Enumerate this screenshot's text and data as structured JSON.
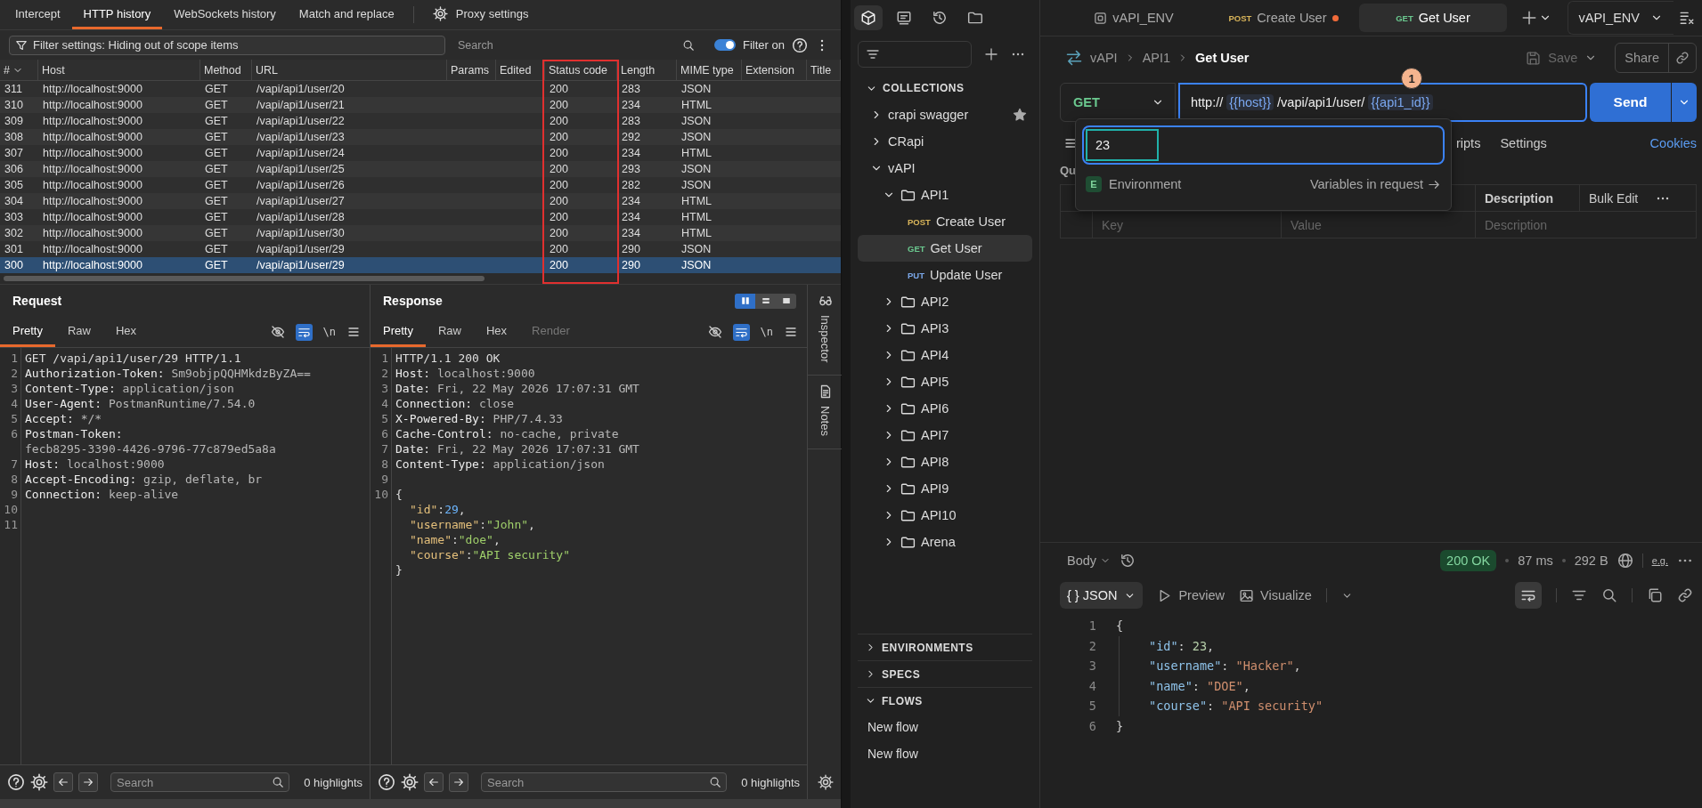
{
  "burp": {
    "tabs": [
      {
        "label": "Intercept",
        "selected": false
      },
      {
        "label": "HTTP history",
        "selected": true
      },
      {
        "label": "WebSockets history",
        "selected": false
      },
      {
        "label": "Match and replace",
        "selected": false
      }
    ],
    "settings_tab": "Proxy settings",
    "filter": {
      "value": "Filter settings: Hiding out of scope items"
    },
    "search": {
      "placeholder": "Search"
    },
    "filter_toggle": {
      "label": "Filter on",
      "on": true
    },
    "table": {
      "columns": [
        {
          "label": "#",
          "highlighted": false
        },
        {
          "label": "Host",
          "highlighted": false
        },
        {
          "label": "Method",
          "highlighted": false
        },
        {
          "label": "URL",
          "highlighted": false
        },
        {
          "label": "Params",
          "highlighted": false
        },
        {
          "label": "Edited",
          "highlighted": false
        },
        {
          "label": "Status code",
          "highlighted": true
        },
        {
          "label": "Length",
          "highlighted": false
        },
        {
          "label": "MIME type",
          "highlighted": false
        },
        {
          "label": "Extension",
          "highlighted": false
        },
        {
          "label": "Title",
          "highlighted": false
        }
      ],
      "rows": [
        {
          "num": "311",
          "host": "http://localhost:9000",
          "method": "GET",
          "url": "/vapi/api1/user/20",
          "status": "200",
          "length": "283",
          "mime": "JSON",
          "selected": false
        },
        {
          "num": "310",
          "host": "http://localhost:9000",
          "method": "GET",
          "url": "/vapi/api1/user/21",
          "status": "200",
          "length": "234",
          "mime": "HTML",
          "selected": false
        },
        {
          "num": "309",
          "host": "http://localhost:9000",
          "method": "GET",
          "url": "/vapi/api1/user/22",
          "status": "200",
          "length": "283",
          "mime": "JSON",
          "selected": false
        },
        {
          "num": "308",
          "host": "http://localhost:9000",
          "method": "GET",
          "url": "/vapi/api1/user/23",
          "status": "200",
          "length": "292",
          "mime": "JSON",
          "selected": false
        },
        {
          "num": "307",
          "host": "http://localhost:9000",
          "method": "GET",
          "url": "/vapi/api1/user/24",
          "status": "200",
          "length": "234",
          "mime": "HTML",
          "selected": false
        },
        {
          "num": "306",
          "host": "http://localhost:9000",
          "method": "GET",
          "url": "/vapi/api1/user/25",
          "status": "200",
          "length": "293",
          "mime": "JSON",
          "selected": false
        },
        {
          "num": "305",
          "host": "http://localhost:9000",
          "method": "GET",
          "url": "/vapi/api1/user/26",
          "status": "200",
          "length": "282",
          "mime": "JSON",
          "selected": false
        },
        {
          "num": "304",
          "host": "http://localhost:9000",
          "method": "GET",
          "url": "/vapi/api1/user/27",
          "status": "200",
          "length": "234",
          "mime": "HTML",
          "selected": false
        },
        {
          "num": "303",
          "host": "http://localhost:9000",
          "method": "GET",
          "url": "/vapi/api1/user/28",
          "status": "200",
          "length": "234",
          "mime": "HTML",
          "selected": false
        },
        {
          "num": "302",
          "host": "http://localhost:9000",
          "method": "GET",
          "url": "/vapi/api1/user/30",
          "status": "200",
          "length": "234",
          "mime": "HTML",
          "selected": false
        },
        {
          "num": "301",
          "host": "http://localhost:9000",
          "method": "GET",
          "url": "/vapi/api1/user/29",
          "status": "200",
          "length": "290",
          "mime": "JSON",
          "selected": false
        },
        {
          "num": "300",
          "host": "http://localhost:9000",
          "method": "GET",
          "url": "/vapi/api1/user/29",
          "status": "200",
          "length": "290",
          "mime": "JSON",
          "selected": true
        }
      ]
    },
    "request": {
      "title": "Request",
      "tabs": [
        {
          "label": "Pretty",
          "selected": true,
          "disabled": false
        },
        {
          "label": "Raw",
          "selected": false,
          "disabled": false
        },
        {
          "label": "Hex",
          "selected": false,
          "disabled": false
        }
      ],
      "wrap_on": true,
      "newline_toggle": "\\n",
      "lines": [
        {
          "n": "1",
          "kind": "text",
          "text": "GET /vapi/api1/user/29 HTTP/1.1"
        },
        {
          "n": "2",
          "kind": "header",
          "name": "Authorization-Token:",
          "value": "Sm9objpQQHMkdzByZA=="
        },
        {
          "n": "3",
          "kind": "header",
          "name": "Content-Type:",
          "value": "application/json"
        },
        {
          "n": "4",
          "kind": "header",
          "name": "User-Agent:",
          "value": "PostmanRuntime/7.54.0"
        },
        {
          "n": "5",
          "kind": "header",
          "name": "Accept:",
          "value": "*/*"
        },
        {
          "n": "6",
          "kind": "header",
          "name": "Postman-Token:",
          "value": "fecb8295-3390-4426-9796-77c879ed5a8a"
        },
        {
          "n": "7",
          "kind": "header",
          "name": "Host:",
          "value": "localhost:9000"
        },
        {
          "n": "8",
          "kind": "header",
          "name": "Accept-Encoding:",
          "value": "gzip, deflate, br"
        },
        {
          "n": "9",
          "kind": "header",
          "name": "Connection:",
          "value": "keep-alive"
        },
        {
          "n": "10",
          "kind": "blank"
        },
        {
          "n": "11",
          "kind": "blank"
        }
      ],
      "search": {
        "placeholder": "Search"
      },
      "highlights": "0 highlights"
    },
    "response": {
      "title": "Response",
      "layouts": [
        {
          "kind": "columns",
          "selected": true
        },
        {
          "kind": "rows",
          "selected": false
        },
        {
          "kind": "single",
          "selected": false
        }
      ],
      "tabs": [
        {
          "label": "Pretty",
          "selected": true,
          "disabled": false
        },
        {
          "label": "Raw",
          "selected": false,
          "disabled": false
        },
        {
          "label": "Hex",
          "selected": false,
          "disabled": false
        },
        {
          "label": "Render",
          "selected": false,
          "disabled": true
        }
      ],
      "wrap_on": true,
      "newline_toggle": "\\n",
      "lines": [
        {
          "n": "1",
          "kind": "text",
          "text": "HTTP/1.1 200 OK"
        },
        {
          "n": "2",
          "kind": "header",
          "name": "Host:",
          "value": "localhost:9000"
        },
        {
          "n": "3",
          "kind": "header",
          "name": "Date:",
          "value": "Fri, 22 May 2026 17:07:31 GMT"
        },
        {
          "n": "4",
          "kind": "header",
          "name": "Connection:",
          "value": "close"
        },
        {
          "n": "5",
          "kind": "header",
          "name": "X-Powered-By:",
          "value": "PHP/7.4.33"
        },
        {
          "n": "6",
          "kind": "header",
          "name": "Cache-Control:",
          "value": "no-cache, private"
        },
        {
          "n": "7",
          "kind": "header",
          "name": "Date:",
          "value": "Fri, 22 May 2026 17:07:31 GMT"
        },
        {
          "n": "8",
          "kind": "header",
          "name": "Content-Type:",
          "value": "application/json"
        },
        {
          "n": "9",
          "kind": "blank"
        },
        {
          "n": "10",
          "kind": "brace",
          "parts": [
            {
              "t": "{",
              "kind": "punct"
            }
          ]
        },
        {
          "kind": "field",
          "parts": [
            {
              "t": "\"id\"",
              "kind": "key"
            },
            {
              "t": ":",
              "kind": "punct"
            },
            {
              "t": "29",
              "kind": "number"
            },
            {
              "t": ",",
              "kind": "punct"
            }
          ]
        },
        {
          "kind": "field",
          "parts": [
            {
              "t": "\"username\"",
              "kind": "key"
            },
            {
              "t": ":",
              "kind": "punct"
            },
            {
              "t": "\"John\"",
              "kind": "string"
            },
            {
              "t": ",",
              "kind": "punct"
            }
          ]
        },
        {
          "kind": "field",
          "parts": [
            {
              "t": "\"name\"",
              "kind": "key"
            },
            {
              "t": ":",
              "kind": "punct"
            },
            {
              "t": "\"doe\"",
              "kind": "string"
            },
            {
              "t": ",",
              "kind": "punct"
            }
          ]
        },
        {
          "kind": "field",
          "parts": [
            {
              "t": "\"course\"",
              "kind": "key"
            },
            {
              "t": ":",
              "kind": "punct"
            },
            {
              "t": "\"API security\"",
              "kind": "string"
            }
          ]
        },
        {
          "kind": "brace",
          "parts": [
            {
              "t": "}",
              "kind": "punct"
            }
          ]
        }
      ],
      "search": {
        "placeholder": "Search"
      },
      "highlights": "0 highlights"
    },
    "side_tabs": [
      "Inspector",
      "Notes"
    ]
  },
  "postman": {
    "sidebar": {
      "modes": [
        {
          "kind": "collections",
          "selected": true
        },
        {
          "kind": "apis",
          "selected": false
        },
        {
          "kind": "history",
          "selected": false
        },
        {
          "kind": "files",
          "selected": false
        }
      ],
      "collections_label": "COLLECTIONS",
      "tree": [
        {
          "kind": "collection",
          "label": "crapi swagger",
          "expanded": false,
          "starred": true
        },
        {
          "kind": "collection",
          "label": "CRapi",
          "expanded": false,
          "starred": false
        },
        {
          "kind": "collection",
          "label": "vAPI",
          "expanded": true,
          "starred": false,
          "children": [
            {
              "kind": "folder",
              "label": "API1",
              "expanded": true,
              "children": [
                {
                  "kind": "request",
                  "method": "POST",
                  "color": "#d9b55a",
                  "label": "Create User",
                  "selected": false
                },
                {
                  "kind": "request",
                  "method": "GET",
                  "color": "#6bc98f",
                  "label": "Get User",
                  "selected": true
                },
                {
                  "kind": "request",
                  "method": "PUT",
                  "color": "#7aa7e8",
                  "label": "Update User",
                  "selected": false
                }
              ]
            },
            {
              "kind": "folder",
              "label": "API2",
              "expanded": false
            },
            {
              "kind": "folder",
              "label": "API3",
              "expanded": false
            },
            {
              "kind": "folder",
              "label": "API4",
              "expanded": false
            },
            {
              "kind": "folder",
              "label": "API5",
              "expanded": false
            },
            {
              "kind": "folder",
              "label": "API6",
              "expanded": false
            },
            {
              "kind": "folder",
              "label": "API7",
              "expanded": false
            },
            {
              "kind": "folder",
              "label": "API8",
              "expanded": false
            },
            {
              "kind": "folder",
              "label": "API9",
              "expanded": false
            },
            {
              "kind": "folder",
              "label": "API10",
              "expanded": false
            },
            {
              "kind": "folder",
              "label": "Arena",
              "expanded": false
            }
          ]
        }
      ],
      "sections": [
        {
          "label": "ENVIRONMENTS",
          "expanded": false
        },
        {
          "label": "SPECS",
          "expanded": false
        },
        {
          "label": "FLOWS",
          "expanded": true,
          "items": [
            "New flow",
            "New flow"
          ]
        }
      ]
    },
    "tabs": [
      {
        "kind": "environment",
        "label": "vAPI_ENV",
        "unsaved": false,
        "selected": false
      },
      {
        "kind": "request",
        "method": "POST",
        "color": "#d9b55a",
        "label": "Create User",
        "unsaved": true,
        "selected": false
      },
      {
        "kind": "request",
        "method": "GET",
        "color": "#6bc98f",
        "label": "Get User",
        "unsaved": false,
        "selected": true
      }
    ],
    "environment": "vAPI_ENV",
    "breadcrumb": [
      "vAPI",
      "API1",
      "Get User"
    ],
    "save": {
      "label": "Save",
      "disabled": true
    },
    "share": "Share",
    "method": {
      "label": "GET",
      "color": "#6bc98f"
    },
    "url": [
      {
        "t": "http://",
        "kind": "text"
      },
      {
        "t": "{{host}}",
        "kind": "variable"
      },
      {
        "t": "/vapi/api1/user/",
        "kind": "text"
      },
      {
        "t": "{{api1_id}}",
        "kind": "variable"
      }
    ],
    "send": "Send",
    "step_badge": "1",
    "variable_popup": {
      "value": "23",
      "scope_badge": "E",
      "scope": "Environment",
      "link": "Variables in request"
    },
    "request_tabs": [
      "ripts",
      "Settings"
    ],
    "cookies": "Cookies",
    "query_label": "Qu",
    "params": {
      "header": [
        "Description",
        "Bulk Edit"
      ],
      "placeholders": [
        "Key",
        "Value",
        "Description"
      ]
    },
    "response": {
      "view": "Body",
      "status": "200 OK",
      "time": "87 ms",
      "size": "292 B",
      "example_label": "e.g.",
      "format": "{ } JSON",
      "views": [
        "Preview",
        "Visualize"
      ],
      "wrap_on": true,
      "lines": [
        {
          "n": "1",
          "kind": "brace",
          "parts": [
            {
              "t": "{",
              "kind": "punct"
            }
          ]
        },
        {
          "n": "2",
          "kind": "field",
          "parts": [
            {
              "t": "\"id\"",
              "kind": "key"
            },
            {
              "t": ": ",
              "kind": "punct"
            },
            {
              "t": "23",
              "kind": "number"
            },
            {
              "t": ",",
              "kind": "punct"
            }
          ]
        },
        {
          "n": "3",
          "kind": "field",
          "parts": [
            {
              "t": "\"username\"",
              "kind": "key"
            },
            {
              "t": ": ",
              "kind": "punct"
            },
            {
              "t": "\"Hacker\"",
              "kind": "string"
            },
            {
              "t": ",",
              "kind": "punct"
            }
          ]
        },
        {
          "n": "4",
          "kind": "field",
          "parts": [
            {
              "t": "\"name\"",
              "kind": "key"
            },
            {
              "t": ": ",
              "kind": "punct"
            },
            {
              "t": "\"DOE\"",
              "kind": "string"
            },
            {
              "t": ",",
              "kind": "punct"
            }
          ]
        },
        {
          "n": "5",
          "kind": "field",
          "parts": [
            {
              "t": "\"course\"",
              "kind": "key"
            },
            {
              "t": ": ",
              "kind": "punct"
            },
            {
              "t": "\"API security\"",
              "kind": "string"
            }
          ]
        },
        {
          "n": "6",
          "kind": "brace",
          "parts": [
            {
              "t": "}",
              "kind": "punct"
            }
          ]
        }
      ]
    }
  }
}
